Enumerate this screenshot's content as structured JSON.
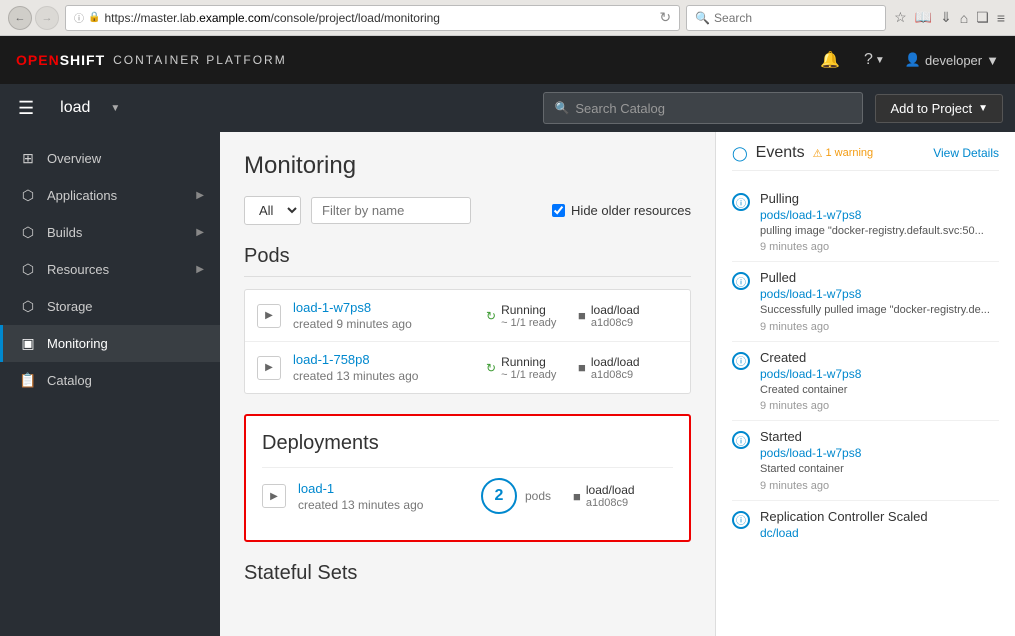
{
  "browser": {
    "back_btn": "←",
    "forward_btn": "→",
    "info_icon": "ℹ",
    "lock_icon": "🔒",
    "url_prefix": "https://master.lab.",
    "url_domain": "example.com",
    "url_path": "/console/project/load/monitoring",
    "reload_icon": "↻",
    "search_placeholder": "Search",
    "star_icon": "☆",
    "bookmark_icon": "📖",
    "download_icon": "⬇",
    "home_icon": "⌂",
    "pocket_icon": "❏",
    "menu_icon": "☰"
  },
  "navbar": {
    "brand_main": "OPENSHIFT",
    "brand_sub": "CONTAINER PLATFORM",
    "bell_icon": "🔔",
    "help_icon": "?",
    "user_icon": "👤",
    "user_name": "developer",
    "user_caret": "▾"
  },
  "project_bar": {
    "hamburger_icon": "☰",
    "project_name": "load",
    "dropdown_icon": "▾",
    "search_placeholder": "Search Catalog",
    "search_icon": "🔍",
    "add_to_project_label": "Add to Project",
    "add_caret": "▾"
  },
  "sidebar": {
    "items": [
      {
        "id": "overview",
        "icon": "⊞",
        "label": "Overview",
        "has_arrow": false,
        "active": false
      },
      {
        "id": "applications",
        "icon": "⬡",
        "label": "Applications",
        "has_arrow": true,
        "active": false
      },
      {
        "id": "builds",
        "icon": "⬡",
        "label": "Builds",
        "has_arrow": true,
        "active": false
      },
      {
        "id": "resources",
        "icon": "⬡",
        "label": "Resources",
        "has_arrow": true,
        "active": false
      },
      {
        "id": "storage",
        "icon": "⬡",
        "label": "Storage",
        "has_arrow": false,
        "active": false
      },
      {
        "id": "monitoring",
        "icon": "▣",
        "label": "Monitoring",
        "has_arrow": false,
        "active": true
      },
      {
        "id": "catalog",
        "icon": "📋",
        "label": "Catalog",
        "has_arrow": false,
        "active": false
      }
    ]
  },
  "monitoring": {
    "page_title": "Monitoring",
    "filter_all_label": "All",
    "filter_placeholder": "Filter by name",
    "hide_older_label": "Hide older resources",
    "pods_section_title": "Pods",
    "pods": [
      {
        "name": "load-1-w7ps8",
        "created": "created 9 minutes ago",
        "status": "Running",
        "ready": "~ 1/1 ready",
        "image_name": "load/load",
        "image_hash": "a1d08c9"
      },
      {
        "name": "load-1-758p8",
        "created": "created 13 minutes ago",
        "status": "Running",
        "ready": "~ 1/1 ready",
        "image_name": "load/load",
        "image_hash": "a1d08c9"
      }
    ],
    "deployments_section_title": "Deployments",
    "deployments": [
      {
        "name": "load-1",
        "created": "created 13 minutes ago",
        "pods_count": "2",
        "pods_label": "pods",
        "image_name": "load/load",
        "image_hash": "a1d08c9"
      }
    ],
    "stateful_sets_title": "Stateful Sets"
  },
  "events": {
    "panel_title": "Events",
    "warning_icon": "⚠",
    "warning_text": "1 warning",
    "view_details_label": "View Details",
    "items": [
      {
        "type": "Pulling",
        "link": "pods/load-1-w7ps8",
        "description": "pulling image \"docker-registry.default.svc:50...",
        "time": "9 minutes ago"
      },
      {
        "type": "Pulled",
        "link": "pods/load-1-w7ps8",
        "description": "Successfully pulled image \"docker-registry.de...",
        "time": "9 minutes ago"
      },
      {
        "type": "Created",
        "link": "pods/load-1-w7ps8",
        "description": "Created container",
        "time": "9 minutes ago"
      },
      {
        "type": "Started",
        "link": "pods/load-1-w7ps8",
        "description": "Started container",
        "time": "9 minutes ago"
      },
      {
        "type": "Replication Controller Scaled",
        "link": "dc/load",
        "description": "",
        "time": ""
      }
    ]
  }
}
